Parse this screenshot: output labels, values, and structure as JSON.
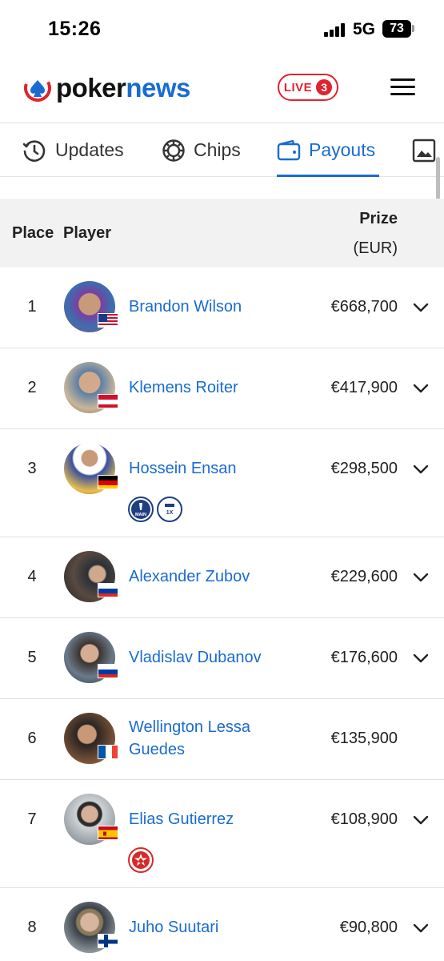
{
  "status_bar": {
    "time": "15:26",
    "network": "5G",
    "battery": "73"
  },
  "header": {
    "logo_part1": "poker",
    "logo_part2": "news",
    "live_label": "LIVE",
    "live_count": "3"
  },
  "tabs": [
    {
      "label": "Updates",
      "icon": "clock-history-icon"
    },
    {
      "label": "Chips",
      "icon": "poker-chip-icon"
    },
    {
      "label": "Payouts",
      "icon": "wallet-icon",
      "active": true
    },
    {
      "label": "",
      "icon": "image-icon"
    }
  ],
  "table": {
    "col_place": "Place",
    "col_player": "Player",
    "col_prize": "Prize",
    "col_prize_unit": "(EUR)",
    "rows": [
      {
        "place": "1",
        "name": "Brandon Wilson",
        "prize": "€668,700",
        "flag": "us"
      },
      {
        "place": "2",
        "name": "Klemens Roiter",
        "prize": "€417,900",
        "flag": "at"
      },
      {
        "place": "3",
        "name": "Hossein Ensan",
        "prize": "€298,500",
        "flag": "de",
        "badges": [
          "MAIN",
          "1X"
        ]
      },
      {
        "place": "4",
        "name": "Alexander Zubov",
        "prize": "€229,600",
        "flag": "ru"
      },
      {
        "place": "5",
        "name": "Vladislav Dubanov",
        "prize": "€176,600",
        "flag": "ru"
      },
      {
        "place": "6",
        "name_line1": "Wellington Lessa",
        "name_line2": "Guedes",
        "prize": "€135,900",
        "flag": "fr"
      },
      {
        "place": "7",
        "name": "Elias Gutierrez",
        "prize": "€108,900",
        "flag": "es",
        "badges": [
          "pokerstars"
        ]
      },
      {
        "place": "8",
        "name": "Juho Suutari",
        "prize": "€90,800",
        "flag": "fi"
      }
    ]
  },
  "colors": {
    "brand_blue": "#1a6bd1",
    "live_red": "#e0242f",
    "header_bg": "#f2f2f2"
  }
}
